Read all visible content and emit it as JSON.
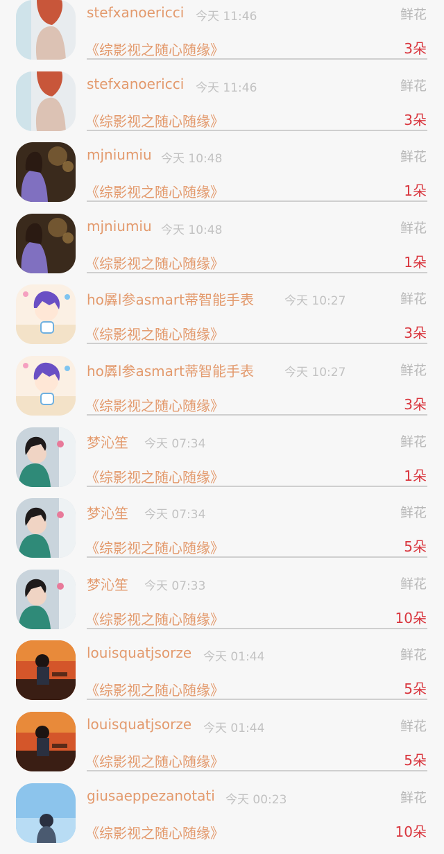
{
  "gift_list": {
    "items": [
      {
        "sender": "stefxanoericci",
        "time": "今天 11:46",
        "gift_type": "鲜花",
        "book_title": "《综影视之随心随缘》",
        "amount": "3朵",
        "avatar": "avatar-back"
      },
      {
        "sender": "stefxanoericci",
        "time": "今天 11:46",
        "gift_type": "鲜花",
        "book_title": "《综影视之随心随缘》",
        "amount": "3朵",
        "avatar": "avatar-back"
      },
      {
        "sender": "mjniumiu",
        "time": "今天 10:48",
        "gift_type": "鲜花",
        "book_title": "《综影视之随心随缘》",
        "amount": "1朵",
        "avatar": "avatar-concert"
      },
      {
        "sender": "mjniumiu",
        "time": "今天 10:48",
        "gift_type": "鲜花",
        "book_title": "《综影视之随心随缘》",
        "amount": "1朵",
        "avatar": "avatar-concert"
      },
      {
        "sender": "ho羼l参asmart蒂智能手表",
        "time": "今天 10:27",
        "gift_type": "鲜花",
        "book_title": "《综影视之随心随缘》",
        "amount": "3朵",
        "avatar": "avatar-anime"
      },
      {
        "sender": "ho羼l参asmart蒂智能手表",
        "time": "今天 10:27",
        "gift_type": "鲜花",
        "book_title": "《综影视之随心随缘》",
        "amount": "3朵",
        "avatar": "avatar-anime"
      },
      {
        "sender": "梦沁笙",
        "time": "今天 07:34",
        "gift_type": "鲜花",
        "book_title": "《综影视之随心随缘》",
        "amount": "1朵",
        "avatar": "avatar-girl-flower"
      },
      {
        "sender": "梦沁笙",
        "time": "今天 07:34",
        "gift_type": "鲜花",
        "book_title": "《综影视之随心随缘》",
        "amount": "5朵",
        "avatar": "avatar-girl-flower"
      },
      {
        "sender": "梦沁笙",
        "time": "今天 07:33",
        "gift_type": "鲜花",
        "book_title": "《综影视之随心随缘》",
        "amount": "10朵",
        "avatar": "avatar-girl-flower"
      },
      {
        "sender": "louisquatjsorze",
        "time": "今天 01:44",
        "gift_type": "鲜花",
        "book_title": "《综影视之随心随缘》",
        "amount": "5朵",
        "avatar": "avatar-sunset-boy"
      },
      {
        "sender": "louisquatjsorze",
        "time": "今天 01:44",
        "gift_type": "鲜花",
        "book_title": "《综影视之随心随缘》",
        "amount": "5朵",
        "avatar": "avatar-sunset-boy"
      },
      {
        "sender": "giusaeppezanotati",
        "time": "今天 00:23",
        "gift_type": "鲜花",
        "book_title": "《综影视之随心随缘》",
        "amount": "10朵",
        "avatar": "avatar-sky-girl"
      }
    ]
  },
  "colors": {
    "sender": "#e39a6d",
    "book_title": "#e39a6d",
    "amount": "#d9363e",
    "muted": "#c2c2c2",
    "background": "#f7f7f7"
  }
}
